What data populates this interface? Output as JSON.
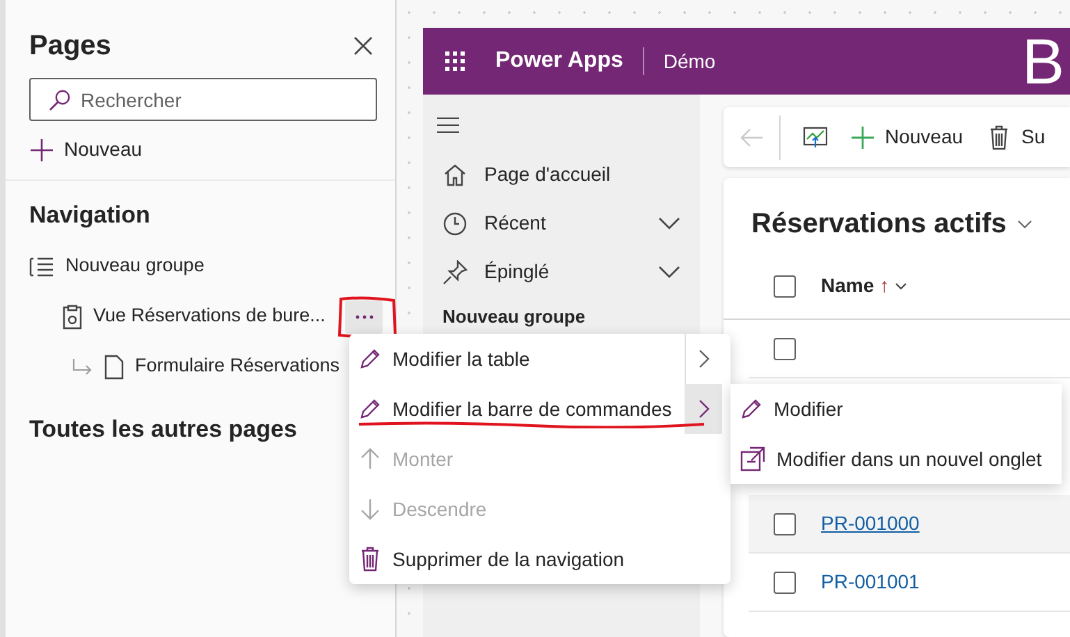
{
  "pages_panel": {
    "title": "Pages",
    "search": {
      "placeholder": "Rechercher"
    },
    "new_label": "Nouveau",
    "navigation_title": "Navigation",
    "tree": [
      {
        "label": "Nouveau groupe",
        "kind": "group",
        "menu_open": false,
        "children": [
          {
            "label": "Vue Réservations de bure...",
            "kind": "view",
            "menu_open": true,
            "circled": true,
            "children": [
              {
                "label": "Formulaire Réservations",
                "kind": "form",
                "menu_open": false
              }
            ]
          }
        ]
      }
    ],
    "other_pages_title": "Toutes les autres pages"
  },
  "app": {
    "brand": "Power Apps",
    "environment": "Démo",
    "banner_text": "B",
    "nav": [
      {
        "label": "Page d'accueil",
        "kind": "home"
      },
      {
        "label": "Récent",
        "kind": "recent",
        "expanded": false
      },
      {
        "label": "Épinglé",
        "kind": "pinned",
        "expanded": false
      }
    ],
    "nav_group": "Nouveau groupe",
    "commands": [
      {
        "kind": "back",
        "disabled": true
      },
      {
        "kind": "chart"
      },
      {
        "kind": "new",
        "label": "Nouveau"
      },
      {
        "kind": "delete",
        "label": "Su"
      }
    ],
    "view_title": "Réservations actifs",
    "column": {
      "label": "Name",
      "sort_arrow": "↑"
    },
    "select_all": {
      "checked": false
    },
    "rows": [
      {
        "name": "",
        "checked": false,
        "highlighted": false
      },
      {
        "name": "PR-001000",
        "checked": false,
        "highlighted": true
      },
      {
        "name": "PR-001001",
        "checked": false,
        "highlighted": false
      }
    ]
  },
  "context_menu": [
    {
      "label": "Modifier la table",
      "kind": "edit",
      "disabled": false,
      "underlined": false,
      "submenu": true,
      "expanded": false
    },
    {
      "label": "Modifier la barre de commandes",
      "kind": "edit",
      "disabled": false,
      "underlined": true,
      "submenu": true,
      "expanded": true
    },
    {
      "label": "Monter",
      "kind": "up",
      "disabled": true,
      "underlined": false
    },
    {
      "label": "Descendre",
      "kind": "down",
      "disabled": true,
      "underlined": false
    },
    {
      "label": "Supprimer de la navigation",
      "kind": "delete",
      "disabled": false,
      "underlined": false
    }
  ],
  "submenu": [
    {
      "label": "Modifier",
      "kind": "edit"
    },
    {
      "label": "Modifier dans un nouvel onglet",
      "kind": "new-tab"
    }
  ]
}
